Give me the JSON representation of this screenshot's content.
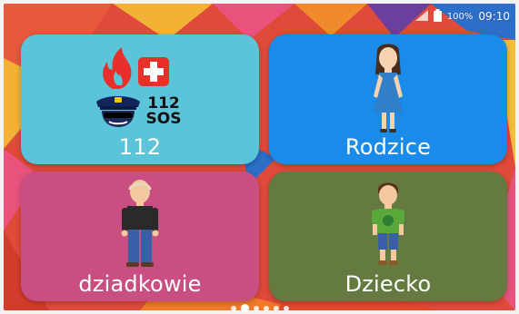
{
  "status_bar": {
    "battery_percent": "100%",
    "time": "09:10"
  },
  "tiles": [
    {
      "id": "112",
      "label": "112",
      "color": "#5bc4d9",
      "icon": "emergency-icons",
      "badge_top": "112",
      "badge_bottom": "SOS"
    },
    {
      "id": "rodzice",
      "label": "Rodzice",
      "color": "#1a8be8",
      "icon": "mother-icon"
    },
    {
      "id": "dziadkowie",
      "label": "dziadkowie",
      "color": "#c94f82",
      "icon": "grandfather-icon"
    },
    {
      "id": "dziecko",
      "label": "Dziecko",
      "color": "#647a41",
      "icon": "child-icon"
    }
  ],
  "page_indicator": {
    "count": 6,
    "active_index": 1
  },
  "colors": {
    "wall_red": "#e4472e",
    "wall_pink": "#e8527c",
    "wall_yellow": "#f4bd3a",
    "wall_blue": "#2d6ec9",
    "wall_purple": "#6b3f9e",
    "wall_orange": "#f07a2a"
  }
}
